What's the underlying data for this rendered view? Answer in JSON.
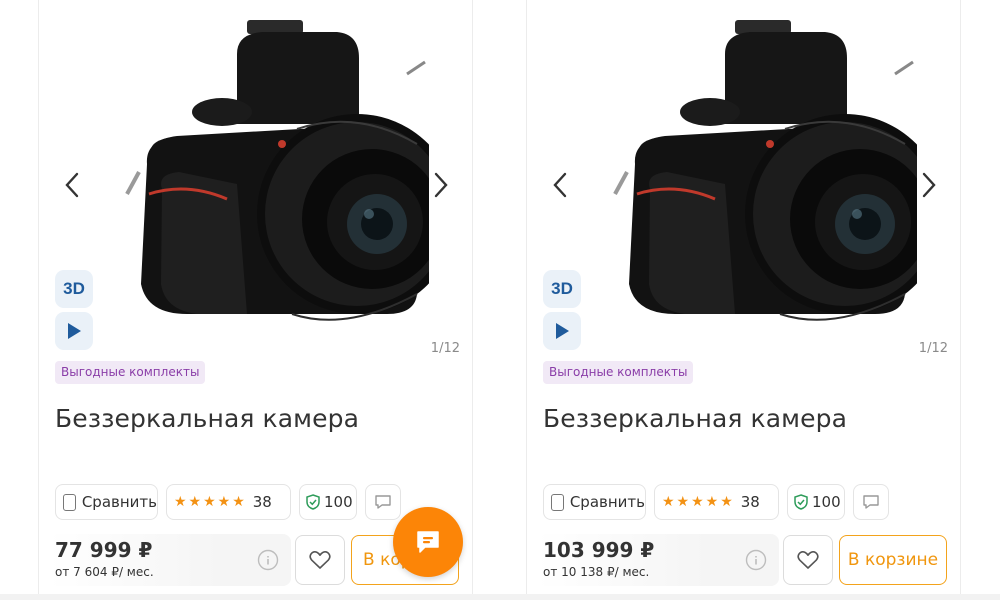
{
  "cards": [
    {
      "badge_3d": "3D",
      "counter": "1/12",
      "promo_tag": "Выгодные комплекты",
      "title": "Беззеркальная камера",
      "compare_label": "Сравнить",
      "rating_stars": 5,
      "rating_count": "38",
      "reliability": "100",
      "price": "77 999 ₽",
      "installment": "от 7 604 ₽/ мес.",
      "cart_label": "В корзине"
    },
    {
      "badge_3d": "3D",
      "counter": "1/12",
      "promo_tag": "Выгодные комплекты",
      "title": "Беззеркальная камера",
      "compare_label": "Сравнить",
      "rating_stars": 5,
      "rating_count": "38",
      "reliability": "100",
      "price": "103 999 ₽",
      "installment": "от 10 138 ₽/ мес.",
      "cart_label": "В корзине"
    }
  ],
  "icons": {
    "prev": "chevron-left-icon",
    "next": "chevron-right-icon",
    "play": "play-icon",
    "shield": "shield-check-icon",
    "comment": "comment-icon",
    "info": "info-icon",
    "heart": "heart-icon",
    "chat": "chat-icon"
  },
  "colors": {
    "accent_orange": "#fc8507",
    "star": "#f39214",
    "brand_blue": "#1f5b9c",
    "promo_purple": "#8a3da8",
    "reliability_green": "#2e9c5a"
  }
}
